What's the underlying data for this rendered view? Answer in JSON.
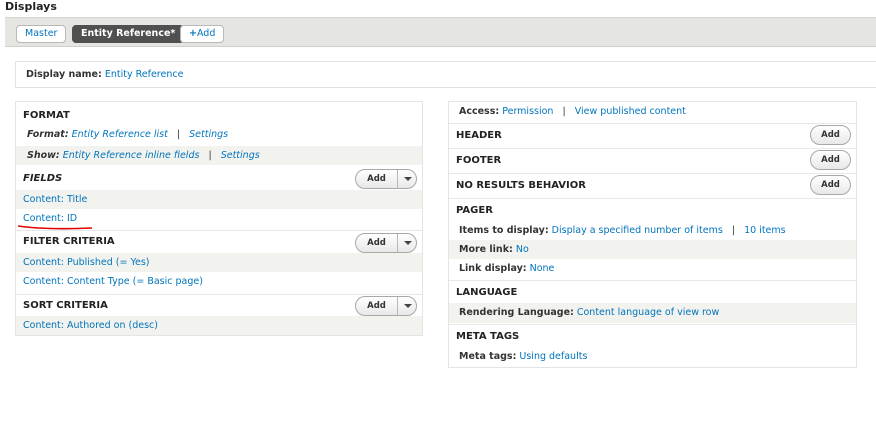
{
  "page": {
    "title": "Displays"
  },
  "tabs": [
    {
      "label": "Master"
    },
    {
      "label": "Entity Reference*"
    },
    {
      "label": "Add",
      "icon": "plus-icon"
    }
  ],
  "display_name": {
    "label": "Display name:",
    "value": "Entity Reference"
  },
  "left": {
    "format": {
      "heading": "FORMAT",
      "format_label": "Format:",
      "format_value": "Entity Reference list",
      "format_settings": "Settings",
      "show_label": "Show:",
      "show_value": "Entity Reference inline fields",
      "show_settings": "Settings"
    },
    "fields": {
      "heading": "FIELDS",
      "add_label": "Add",
      "items": [
        "Content: Title",
        "Content: ID"
      ]
    },
    "filter": {
      "heading": "FILTER CRITERIA",
      "add_label": "Add",
      "items": [
        "Content: Published (= Yes)",
        "Content: Content Type (= Basic page)"
      ]
    },
    "sort": {
      "heading": "SORT CRITERIA",
      "add_label": "Add",
      "items": [
        "Content: Authored on (desc)"
      ]
    }
  },
  "right": {
    "access": {
      "label": "Access:",
      "value": "Permission",
      "extra": "View published content"
    },
    "header": {
      "heading": "HEADER",
      "add_label": "Add"
    },
    "footer": {
      "heading": "FOOTER",
      "add_label": "Add"
    },
    "no_results": {
      "heading": "NO RESULTS BEHAVIOR",
      "add_label": "Add"
    },
    "pager": {
      "heading": "PAGER",
      "items_label": "Items to display:",
      "items_value": "Display a specified number of items",
      "items_count": "10 items",
      "more_label": "More link:",
      "more_value": "No",
      "link_label": "Link display:",
      "link_value": "None"
    },
    "language": {
      "heading": "LANGUAGE",
      "label": "Rendering Language:",
      "value": "Content language of view row"
    },
    "meta": {
      "heading": "META TAGS",
      "label": "Meta tags:",
      "value": "Using defaults"
    }
  },
  "colors": {
    "link": "#0074bd",
    "active_tab": "#505050",
    "annotation": "#e00000"
  }
}
